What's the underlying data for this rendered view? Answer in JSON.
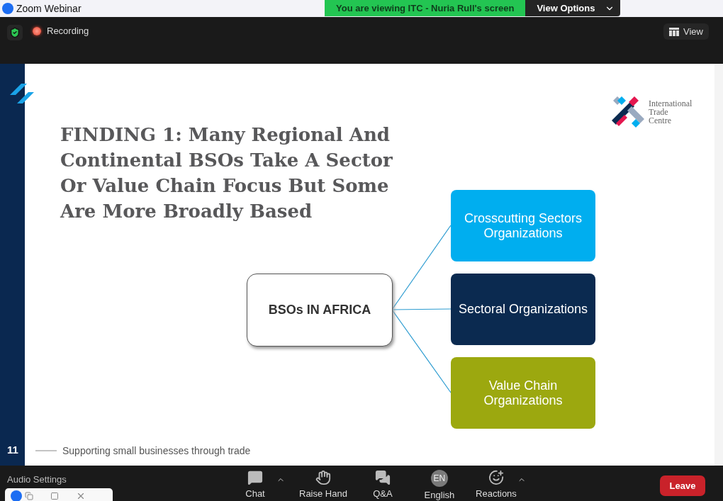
{
  "app": {
    "title": "Zoom Webinar"
  },
  "share_banner": {
    "text": "You are viewing ITC - Nuria Rull's screen",
    "options_button": "View Options"
  },
  "top_bar": {
    "recording": "Recording",
    "view_button": "View"
  },
  "slide": {
    "title": "FINDING 1: Many Regional And Continental BSOs Take A Sector Or Value Chain Focus But Some Are More Broadly Based",
    "logo_lines": [
      "International",
      "Trade",
      "Centre"
    ],
    "diagram": {
      "root": "BSOs IN AFRICA",
      "branches": [
        {
          "label": "Crosscutting Sectors Organizations",
          "color": "#00aeef"
        },
        {
          "label": "Sectoral Organizations",
          "color": "#0b2a50"
        },
        {
          "label": "Value Chain Organizations",
          "color": "#9ca80f"
        }
      ]
    },
    "page_number": "11",
    "footer": "Supporting small businesses through trade"
  },
  "toolbar": {
    "audio_settings": "Audio Settings",
    "buttons": [
      {
        "label": "Chat",
        "kind": "chat",
        "caret": true
      },
      {
        "label": "Raise Hand",
        "kind": "hand",
        "caret": false
      },
      {
        "label": "Q&A",
        "kind": "qa",
        "caret": false
      },
      {
        "label": "English",
        "kind": "language",
        "badge": "EN",
        "caret": false
      },
      {
        "label": "Reactions",
        "kind": "reactions",
        "caret": true
      }
    ],
    "leave": "Leave"
  }
}
